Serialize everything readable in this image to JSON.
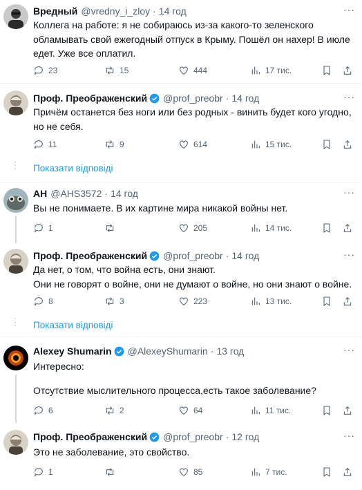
{
  "tweets": [
    {
      "name": "Вредный",
      "handle": "@vredny_i_zloy",
      "time": "14 год",
      "verified": false,
      "lines": [
        "Коллега на работе: я не собираюсь из-за какого-то зеленского",
        "обламывать свой ежегодный отпуск в Крыму. Пошёл он нахер! В июле",
        "едет. Уже все оплатил."
      ],
      "replies": "23",
      "retweets": "15",
      "likes": "444",
      "views": "17 тис."
    },
    {
      "name": "Проф. Преображенский",
      "handle": "@prof_preobr",
      "time": "14 год",
      "verified": true,
      "lines": [
        "Причём останется без ноги или без родных - винить будет кого угодно,",
        "но не себя."
      ],
      "replies": "11",
      "retweets": "9",
      "likes": "614",
      "views": "15 тис."
    },
    {
      "name": "АН",
      "handle": "@AHS3572",
      "time": "14 год",
      "verified": false,
      "lines": [
        "Вы не понимаете. В их картине мира никакой войны нет."
      ],
      "replies": "1",
      "retweets": "",
      "likes": "205",
      "views": "14 тис."
    },
    {
      "name": "Проф. Преображенский",
      "handle": "@prof_preobr",
      "time": "14 год",
      "verified": true,
      "lines": [
        "Да нет, о том, что война есть, они знают.",
        "Они не говорят о войне, они не думают о войне, но они знают о войне."
      ],
      "replies": "8",
      "retweets": "3",
      "likes": "223",
      "views": "13 тис."
    },
    {
      "name": "Alexey Shumarin",
      "handle": "@AlexeyShumarin",
      "time": "13 год",
      "verified": true,
      "lines": [
        "Интересно:",
        "",
        "Отсутствие мыслительного процесса,есть такое заболевание?"
      ],
      "replies": "6",
      "retweets": "2",
      "likes": "64",
      "views": "11 тис."
    },
    {
      "name": "Проф. Преображенский",
      "handle": "@prof_preobr",
      "time": "12 год",
      "verified": true,
      "lines": [
        "Это не заболевание, это свойство."
      ],
      "replies": "1",
      "retweets": "",
      "likes": "85",
      "views": "7 тис."
    }
  ],
  "show_replies_label": "Показати відповіді",
  "dot": "·",
  "more": "···",
  "colors": {
    "accent": "#1d9bf0",
    "muted": "#536471",
    "line": "#cfd9de"
  }
}
